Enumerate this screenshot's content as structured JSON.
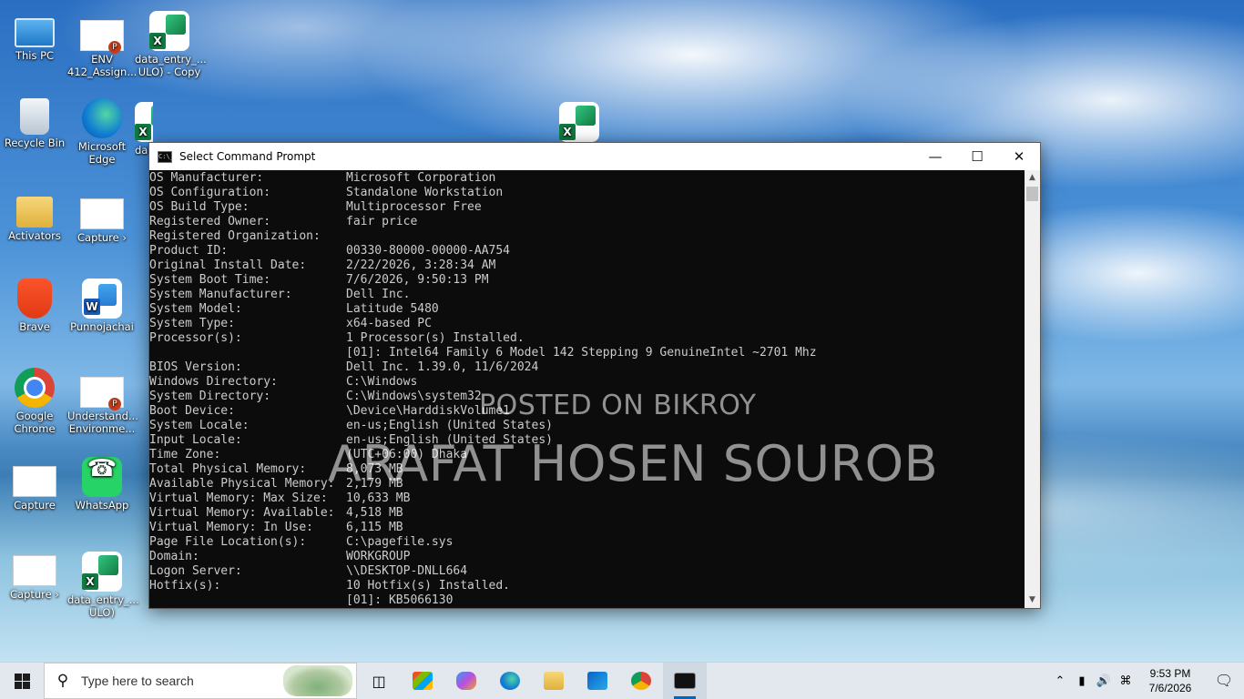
{
  "desktop_icons": [
    {
      "label": "This PC"
    },
    {
      "label": "ENV 412_Assign..."
    },
    {
      "label": "data_entry_... ULO) - Copy"
    },
    {
      "label": "Recycle Bin"
    },
    {
      "label": "Microsoft Edge"
    },
    {
      "label": "data_..."
    },
    {
      "label": "Activators"
    },
    {
      "label": "Capture ›"
    },
    {
      "label": "Brave"
    },
    {
      "label": "Punnojachai"
    },
    {
      "label": "Google Chrome"
    },
    {
      "label": "Understand... Environme..."
    },
    {
      "label": "Capture"
    },
    {
      "label": "WhatsApp"
    },
    {
      "label": "Capture ›"
    },
    {
      "label": "data_entry_... ULO)"
    }
  ],
  "cmd_window": {
    "title": "Select Command Prompt",
    "icon_text": "C:\\_",
    "lines": [
      {
        "k": "OS Manufacturer:",
        "v": "Microsoft Corporation"
      },
      {
        "k": "OS Configuration:",
        "v": "Standalone Workstation"
      },
      {
        "k": "OS Build Type:",
        "v": "Multiprocessor Free"
      },
      {
        "k": "Registered Owner:",
        "v": "fair price"
      },
      {
        "k": "Registered Organization:",
        "v": ""
      },
      {
        "k": "Product ID:",
        "v": "00330-80000-00000-AA754"
      },
      {
        "k": "Original Install Date:",
        "v": "2/22/2026, 3:28:34 AM"
      },
      {
        "k": "System Boot Time:",
        "v": "7/6/2026, 9:50:13 PM"
      },
      {
        "k": "System Manufacturer:",
        "v": "Dell Inc."
      },
      {
        "k": "System Model:",
        "v": "Latitude 5480"
      },
      {
        "k": "System Type:",
        "v": "x64-based PC"
      },
      {
        "k": "Processor(s):",
        "v": "1 Processor(s) Installed."
      },
      {
        "k": "",
        "v": "[01]: Intel64 Family 6 Model 142 Stepping 9 GenuineIntel ~2701 Mhz"
      },
      {
        "k": "BIOS Version:",
        "v": "Dell Inc. 1.39.0, 11/6/2024"
      },
      {
        "k": "Windows Directory:",
        "v": "C:\\Windows"
      },
      {
        "k": "System Directory:",
        "v": "C:\\Windows\\system32"
      },
      {
        "k": "Boot Device:",
        "v": "\\Device\\HarddiskVolume1"
      },
      {
        "k": "System Locale:",
        "v": "en-us;English (United States)"
      },
      {
        "k": "Input Locale:",
        "v": "en-us;English (United States)"
      },
      {
        "k": "Time Zone:",
        "v": "(UTC+06:00) Dhaka"
      },
      {
        "k": "Total Physical Memory:",
        "v": "8,073 MB"
      },
      {
        "k": "Available Physical Memory:",
        "v": "2,179 MB"
      },
      {
        "k": "Virtual Memory: Max Size:",
        "v": "10,633 MB"
      },
      {
        "k": "Virtual Memory: Available:",
        "v": "4,518 MB"
      },
      {
        "k": "Virtual Memory: In Use:",
        "v": "6,115 MB"
      },
      {
        "k": "Page File Location(s):",
        "v": "C:\\pagefile.sys"
      },
      {
        "k": "Domain:",
        "v": "WORKGROUP"
      },
      {
        "k": "Logon Server:",
        "v": "\\\\DESKTOP-DNLL664"
      },
      {
        "k": "Hotfix(s):",
        "v": "10 Hotfix(s) Installed."
      },
      {
        "k": "",
        "v": "[01]: KB5066130"
      }
    ]
  },
  "watermark": {
    "line1": "POSTED ON BIKROY",
    "line2": "ARAFAT HOSEN SOUROB"
  },
  "taskbar": {
    "search_placeholder": "Type here to search",
    "apps": [
      "task-view",
      "microsoft-store",
      "copilot",
      "edge",
      "file-explorer",
      "outlook",
      "chrome",
      "command-prompt"
    ],
    "active_app": "command-prompt",
    "clock_time": "9:53 PM",
    "clock_date": "7/6/2026"
  }
}
